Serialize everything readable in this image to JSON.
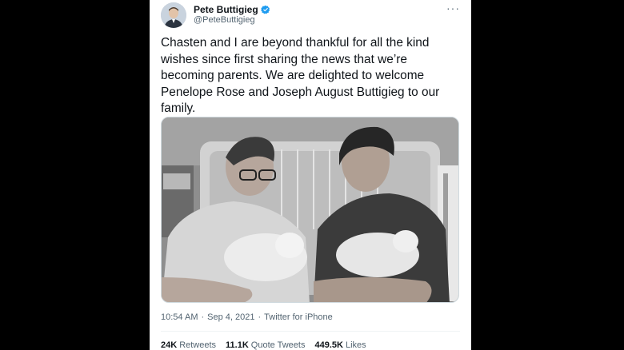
{
  "author": {
    "name": "Pete Buttigieg",
    "handle": "@PeteButtigieg",
    "verified_icon": "verified-badge-icon",
    "verified_color": "#1d9bf0"
  },
  "more_menu": "···",
  "tweet": {
    "text": "Chasten and I are beyond thankful for all the kind wishes since first sharing the news that we’re becoming parents. We are delighted to welcome Penelope Rose and Joseph August Buttigieg to our family."
  },
  "meta": {
    "time": "10:54 AM",
    "sep1": "·",
    "date": "Sep 4, 2021",
    "sep2": "·",
    "source": "Twitter for iPhone"
  },
  "stats": {
    "retweets_count": "24K",
    "retweets_label": "Retweets",
    "quotes_count": "11.1K",
    "quotes_label": "Quote Tweets",
    "likes_count": "449.5K",
    "likes_label": "Likes"
  }
}
